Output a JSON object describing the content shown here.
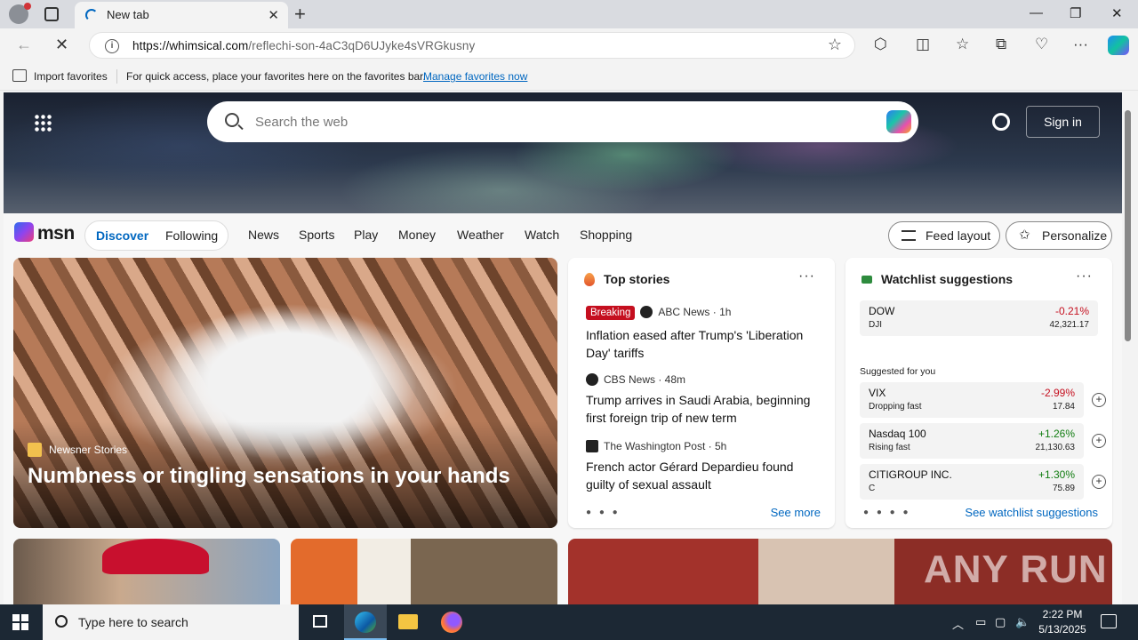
{
  "browser": {
    "tab_title": "New tab",
    "url_host": "https://whimsical.com",
    "url_path": "/reflechi-son-4aC3qD6UJyke4sVRGkusny",
    "favbar": {
      "import_label": "Import favorites",
      "hint": "For quick access, place your favorites here on the favorites bar.",
      "manage_link": "Manage favorites now"
    }
  },
  "msn": {
    "search_placeholder": "Search the web",
    "signin_label": "Sign in",
    "logo_text": "msn",
    "tabs": [
      "Discover",
      "Following"
    ],
    "nav_links": [
      "News",
      "Sports",
      "Play",
      "Money",
      "Weather",
      "Watch",
      "Shopping"
    ],
    "feed_layout_label": "Feed layout",
    "personalize_label": "Personalize",
    "hero": {
      "source": "Newsner Stories",
      "headline": "Numbness or tingling sensations in your hands"
    },
    "top_stories": {
      "title": "Top stories",
      "see_more": "See more",
      "items": [
        {
          "badge": "Breaking",
          "source": "ABC News · 1h",
          "title": "Inflation eased after Trump's 'Liberation Day' tariffs"
        },
        {
          "badge": "",
          "source": "CBS News · 48m",
          "title": "Trump arrives in Saudi Arabia, beginning first foreign trip of new term"
        },
        {
          "badge": "",
          "source": "The Washington Post · 5h",
          "title": "French actor Gérard Depardieu found guilty of sexual assault"
        }
      ]
    },
    "watchlist": {
      "title": "Watchlist suggestions",
      "suggested_label": "Suggested for you",
      "see_link": "See watchlist suggestions",
      "main": {
        "symbol": "DOW",
        "sub": "DJI",
        "change": "-0.21%",
        "price": "42,321.17"
      },
      "items": [
        {
          "symbol": "VIX",
          "sub": "Dropping fast",
          "change": "-2.99%",
          "price": "17.84"
        },
        {
          "symbol": "Nasdaq 100",
          "sub": "Rising fast",
          "change": "+1.26%",
          "price": "21,130.63"
        },
        {
          "symbol": "CITIGROUP INC.",
          "sub": "C",
          "change": "+1.30%",
          "price": "75.89"
        }
      ]
    },
    "watermark": "ANY RUN"
  },
  "taskbar": {
    "search_placeholder": "Type here to search",
    "time": "2:22 PM",
    "date": "5/13/2025"
  }
}
